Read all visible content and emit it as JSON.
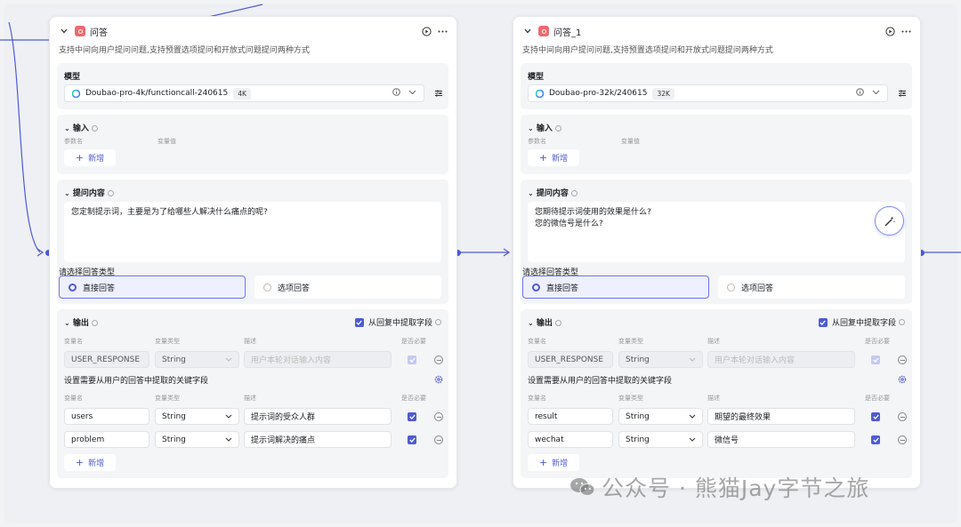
{
  "nodes": [
    {
      "title": "问答",
      "description": "支持中间向用户提问问题,支持预置选项提问和开放式问题提问两种方式",
      "model": {
        "label": "模型",
        "name": "Doubao-pro-4k/functioncall-240615",
        "badge": "4K"
      },
      "input": {
        "label": "输入",
        "col_name": "参数名",
        "col_value": "变量值",
        "add": "新增"
      },
      "ask": {
        "label": "提问内容",
        "lines": [
          "您定制提示词，主要是为了给哪些人解决什么痛点的呢?"
        ]
      },
      "answer_type": {
        "label": "请选择回答类型",
        "options": [
          "直接回答",
          "选项回答"
        ],
        "selected": 0
      },
      "output": {
        "label": "输出",
        "extract_label": "从回复中提取字段",
        "cols": [
          "变量名",
          "变量类型",
          "描述",
          "是否必要"
        ],
        "fixed_row": {
          "name": "USER_RESPONSE",
          "type": "String",
          "desc_placeholder": "用户本轮对话输入内容"
        },
        "extract_title": "设置需要从用户的回答中提取的关键字段",
        "rows": [
          {
            "name": "users",
            "type": "String",
            "desc": "提示词的受众人群"
          },
          {
            "name": "problem",
            "type": "String",
            "desc": "提示词解决的痛点"
          }
        ],
        "add": "新增"
      }
    },
    {
      "title": "问答_1",
      "description": "支持中间向用户提问问题,支持预置选项提问和开放式问题提问两种方式",
      "model": {
        "label": "模型",
        "name": "Doubao-pro-32k/240615",
        "badge": "32K"
      },
      "input": {
        "label": "输入",
        "col_name": "参数名",
        "col_value": "变量值",
        "add": "新增"
      },
      "ask": {
        "label": "提问内容",
        "lines": [
          "您期待提示词使用的效果是什么?",
          "您的微信号是什么?"
        ]
      },
      "answer_type": {
        "label": "请选择回答类型",
        "options": [
          "直接回答",
          "选项回答"
        ],
        "selected": 0
      },
      "output": {
        "label": "输出",
        "extract_label": "从回复中提取字段",
        "cols": [
          "变量名",
          "变量类型",
          "描述",
          "是否必要"
        ],
        "fixed_row": {
          "name": "USER_RESPONSE",
          "type": "String",
          "desc_placeholder": "用户本轮对话输入内容"
        },
        "extract_title": "设置需要从用户的回答中提取的关键字段",
        "rows": [
          {
            "name": "result",
            "type": "String",
            "desc": "期望的最终效果"
          },
          {
            "name": "wechat",
            "type": "String",
            "desc": "微信号"
          }
        ],
        "add": "新增"
      }
    }
  ],
  "watermark": "公众号 · 熊猫Jay字节之旅",
  "colors": {
    "accent": "#4e5bd4",
    "node_icon": "#f0686e",
    "canvas": "#eef0f4"
  }
}
